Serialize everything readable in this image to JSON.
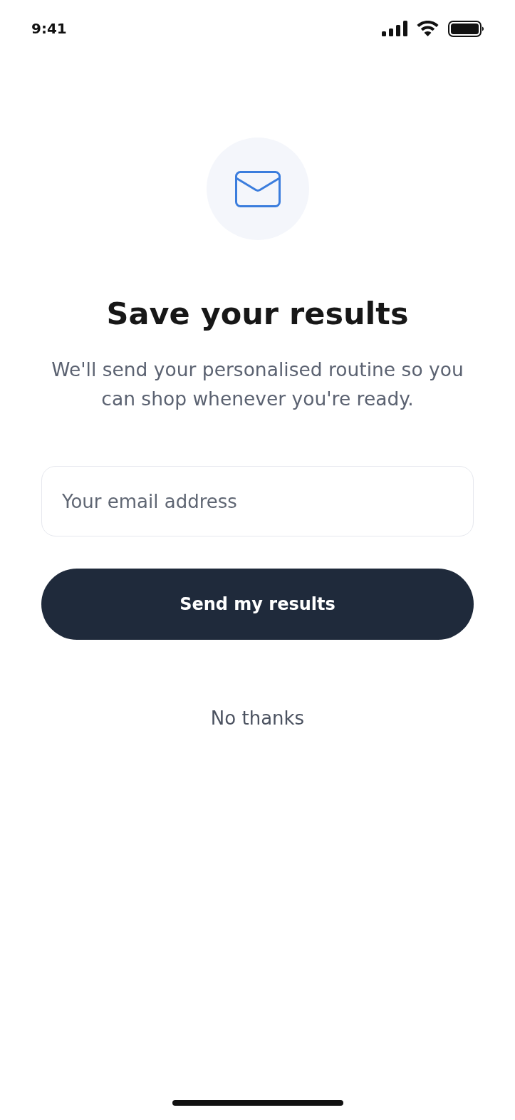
{
  "status_bar": {
    "time": "9:41"
  },
  "title": "Save your results",
  "subtitle": "We'll send your personalised routine so you can shop whenever you're ready.",
  "email_field": {
    "placeholder": "Your email address"
  },
  "primary_button": {
    "label": "Send my results"
  },
  "secondary_link": {
    "label": "No thanks"
  }
}
